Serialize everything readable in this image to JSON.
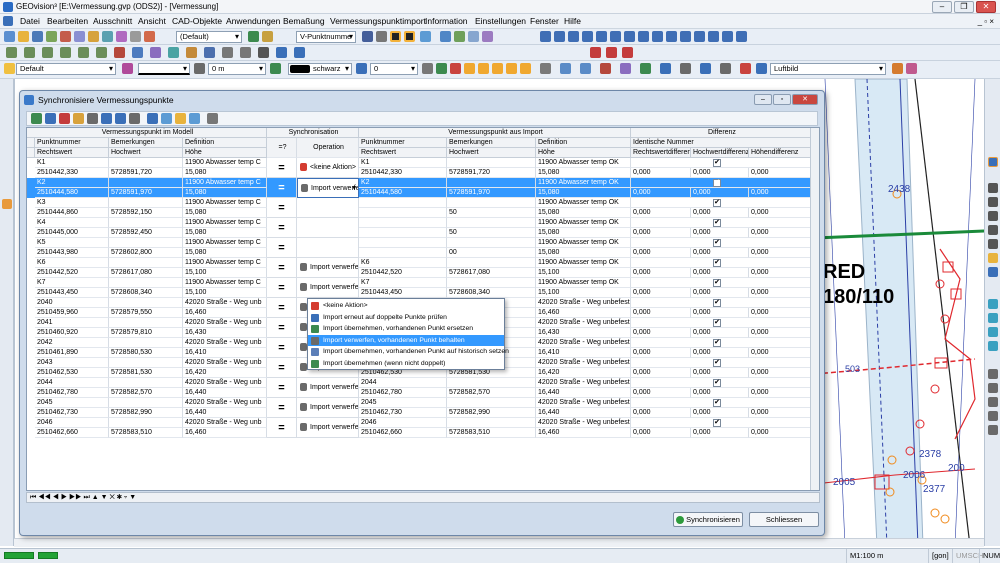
{
  "window": {
    "title": "GEOvision³  [E:\\Vermessung.gvp (ODS2)] - [Vermessung]",
    "buttons": [
      "–",
      "❐",
      "✕"
    ]
  },
  "menu": [
    "Datei",
    "Bearbeiten",
    "Ausschnitt",
    "Ansicht",
    "CAD-Objekte",
    "Anwendungen",
    "Bemaßung",
    "Vermessungspunktimport",
    "Information",
    "Einstellungen",
    "Fenster",
    "Hilfe"
  ],
  "mdi_controls": "_ ▫ ×",
  "toolbar1": {
    "view_combo": "(Default)",
    "vp_combo": "V-Punktnumme"
  },
  "toolbar3": {
    "style_combo": "Default",
    "offset_combo": "0 m",
    "color_combo": "schwarz",
    "level_combo": "0",
    "layer_combo": "Luftbild"
  },
  "map": {
    "labels": [
      "2438",
      "RED",
      "180/110",
      "503",
      "2378",
      "2006",
      "200",
      "2005",
      "2377"
    ],
    "colors": {
      "green": "#1a8a3a",
      "red": "#e0282e",
      "blue": "#2b3fa6",
      "orange": "#f08a1c"
    }
  },
  "status": {
    "scale": "M1:100 m",
    "mode": "[gon]",
    "umsch": "UMSCH",
    "num": "NUM"
  },
  "dialog": {
    "title": "Synchronisiere Vermessungspunkte",
    "group_headers": {
      "model": "Vermessungspunkt im Modell",
      "sync": "Synchronisation",
      "import": "Vermessungspunkt aus Import",
      "diff": "Differenz"
    },
    "col_headers": {
      "punktnummer": "Punktnummer",
      "bemerkungen": "Bemerkungen",
      "definition": "Definition",
      "rechtswert": "Rechtswert",
      "hochwert": "Hochwert",
      "hoehe": "Höhe",
      "eq": "=?",
      "operation": "Operation",
      "identische": "Identische Nummer",
      "rw_diff": "Rechtswertdifferenz",
      "hw_diff": "Hochwertdifferenz",
      "h_diff": "Höhendifferenz"
    },
    "rows": [
      {
        "m_nr": "K1",
        "m_rw": "2510442,330",
        "m_hw": "5728591,720",
        "m_def": "11900 Abwasser temp C",
        "m_h": "15,080",
        "op": "<keine Aktion>",
        "i_nr": "K1",
        "i_rw": "2510442,330",
        "i_hw": "5728591,720",
        "i_def": "11900 Abwasser temp OK",
        "i_h": "15,080",
        "d_rw": "0,000",
        "d_hw": "0,000",
        "d_h": "0,000",
        "ident": "✔"
      },
      {
        "m_nr": "K2",
        "m_rw": "2510444,580",
        "m_hw": "5728591,970",
        "m_def": "11900 Abwasser temp C",
        "m_h": "15,080",
        "op": "Import verwerfen",
        "i_nr": "K2",
        "i_rw": "2510444,580",
        "i_hw": "5728591,970",
        "i_def": "11900 Abwasser temp OK",
        "i_h": "15,080",
        "d_rw": "0,000",
        "d_hw": "0,000",
        "d_h": "0,000",
        "ident": "✔"
      },
      {
        "m_nr": "K3",
        "m_rw": "2510444,860",
        "m_hw": "5728592,150",
        "m_def": "11900 Abwasser temp C",
        "m_h": "15,080",
        "op": "",
        "i_nr": "",
        "i_rw": "",
        "i_hw": "50",
        "i_def": "11900 Abwasser temp OK",
        "i_h": "15,080",
        "d_rw": "0,000",
        "d_hw": "0,000",
        "d_h": "0,000",
        "ident": "✔"
      },
      {
        "m_nr": "K4",
        "m_rw": "2510445,000",
        "m_hw": "5728592,450",
        "m_def": "11900 Abwasser temp C",
        "m_h": "15,080",
        "op": "",
        "i_nr": "",
        "i_rw": "",
        "i_hw": "50",
        "i_def": "11900 Abwasser temp OK",
        "i_h": "15,080",
        "d_rw": "0,000",
        "d_hw": "0,000",
        "d_h": "0,000",
        "ident": "✔"
      },
      {
        "m_nr": "K5",
        "m_rw": "2510443,980",
        "m_hw": "5728602,800",
        "m_def": "11900 Abwasser temp C",
        "m_h": "15,080",
        "op": "",
        "i_nr": "",
        "i_rw": "",
        "i_hw": "00",
        "i_def": "11900 Abwasser temp OK",
        "i_h": "15,080",
        "d_rw": "0,000",
        "d_hw": "0,000",
        "d_h": "0,000",
        "ident": "✔"
      },
      {
        "m_nr": "K6",
        "m_rw": "2510442,520",
        "m_hw": "5728617,080",
        "m_def": "11900 Abwasser temp C",
        "m_h": "15,100",
        "op": "Import verwerfen, vo",
        "i_nr": "K6",
        "i_rw": "2510442,520",
        "i_hw": "5728617,080",
        "i_def": "11900 Abwasser temp OK",
        "i_h": "15,100",
        "d_rw": "0,000",
        "d_hw": "0,000",
        "d_h": "0,000",
        "ident": "✔"
      },
      {
        "m_nr": "K7",
        "m_rw": "2510443,450",
        "m_hw": "5728608,340",
        "m_def": "11900 Abwasser temp C",
        "m_h": "15,100",
        "op": "Import verwerfen, vo",
        "i_nr": "K7",
        "i_rw": "2510443,450",
        "i_hw": "5728608,340",
        "i_def": "11900 Abwasser temp OK",
        "i_h": "15,100",
        "d_rw": "0,000",
        "d_hw": "0,000",
        "d_h": "0,000",
        "ident": "✔"
      },
      {
        "m_nr": "2040",
        "m_rw": "2510459,960",
        "m_hw": "5728579,550",
        "m_def": "42020 Straße - Weg unb",
        "m_h": "16,460",
        "op": "Import verwerfen, vo",
        "i_nr": "2040",
        "i_rw": "2510459,960",
        "i_hw": "5728579,550",
        "i_def": "42020 Straße - Weg unbefest",
        "i_h": "16,460",
        "d_rw": "0,000",
        "d_hw": "0,000",
        "d_h": "0,000",
        "ident": "✔"
      },
      {
        "m_nr": "2041",
        "m_rw": "2510460,920",
        "m_hw": "5728579,810",
        "m_def": "42020 Straße - Weg unb",
        "m_h": "16,430",
        "op": "Import verwerfen, vo",
        "i_nr": "2041",
        "i_rw": "2510460,920",
        "i_hw": "5728579,810",
        "i_def": "42020 Straße - Weg unbefest",
        "i_h": "16,430",
        "d_rw": "0,000",
        "d_hw": "0,000",
        "d_h": "0,000",
        "ident": "✔"
      },
      {
        "m_nr": "2042",
        "m_rw": "2510461,890",
        "m_hw": "5728580,530",
        "m_def": "42020 Straße - Weg unb",
        "m_h": "16,410",
        "op": "Import verwerfen, vo",
        "i_nr": "2042",
        "i_rw": "2510461,890",
        "i_hw": "5728580,530",
        "i_def": "42020 Straße - Weg unbefest",
        "i_h": "16,410",
        "d_rw": "0,000",
        "d_hw": "0,000",
        "d_h": "0,000",
        "ident": "✔"
      },
      {
        "m_nr": "2043",
        "m_rw": "2510462,530",
        "m_hw": "5728581,530",
        "m_def": "42020 Straße - Weg unb",
        "m_h": "16,420",
        "op": "Import verwerfen, vo",
        "i_nr": "2043",
        "i_rw": "2510462,530",
        "i_hw": "5728581,530",
        "i_def": "42020 Straße - Weg unbefest",
        "i_h": "16,420",
        "d_rw": "0,000",
        "d_hw": "0,000",
        "d_h": "0,000",
        "ident": "✔"
      },
      {
        "m_nr": "2044",
        "m_rw": "2510462,780",
        "m_hw": "5728582,570",
        "m_def": "42020 Straße - Weg unb",
        "m_h": "16,440",
        "op": "Import verwerfen, vo",
        "i_nr": "2044",
        "i_rw": "2510462,780",
        "i_hw": "5728582,570",
        "i_def": "42020 Straße - Weg unbefest",
        "i_h": "16,440",
        "d_rw": "0,000",
        "d_hw": "0,000",
        "d_h": "0,000",
        "ident": "✔"
      },
      {
        "m_nr": "2045",
        "m_rw": "2510462,730",
        "m_hw": "5728582,990",
        "m_def": "42020 Straße - Weg unb",
        "m_h": "16,440",
        "op": "Import verwerfen, vo",
        "i_nr": "2045",
        "i_rw": "2510462,730",
        "i_hw": "5728582,990",
        "i_def": "42020 Straße - Weg unbefest",
        "i_h": "16,440",
        "d_rw": "0,000",
        "d_hw": "0,000",
        "d_h": "0,000",
        "ident": "✔"
      },
      {
        "m_nr": "2046",
        "m_rw": "2510462,660",
        "m_hw": "5728583,510",
        "m_def": "42020 Straße - Weg unb",
        "m_h": "16,460",
        "op": "Import verwerfen, vo",
        "i_nr": "2046",
        "i_rw": "2510462,660",
        "i_hw": "5728583,510",
        "i_def": "42020 Straße - Weg unbefest",
        "i_h": "16,460",
        "d_rw": "0,000",
        "d_hw": "0,000",
        "d_h": "0,000",
        "ident": "✔"
      }
    ],
    "dropdown": [
      "<keine Aktion>",
      "Import erneut auf doppelte Punkte prüfen",
      "Import übernehmen, vorhandenen Punkt ersetzen",
      "Import verwerfen, vorhandenen Punkt behalten",
      "Import übernehmen, vorhandenen Punkt auf historisch setzen",
      "Import übernehmen (wenn nicht doppelt)"
    ],
    "dropdown_selected": 3,
    "nav": "⏮ ◀◀ ◀ ▶ ▶▶ ⏭ ▲ ▼ ✕ ✱ ▿ ▼",
    "btn_sync": "Synchronisieren",
    "btn_close": "Schliessen"
  }
}
